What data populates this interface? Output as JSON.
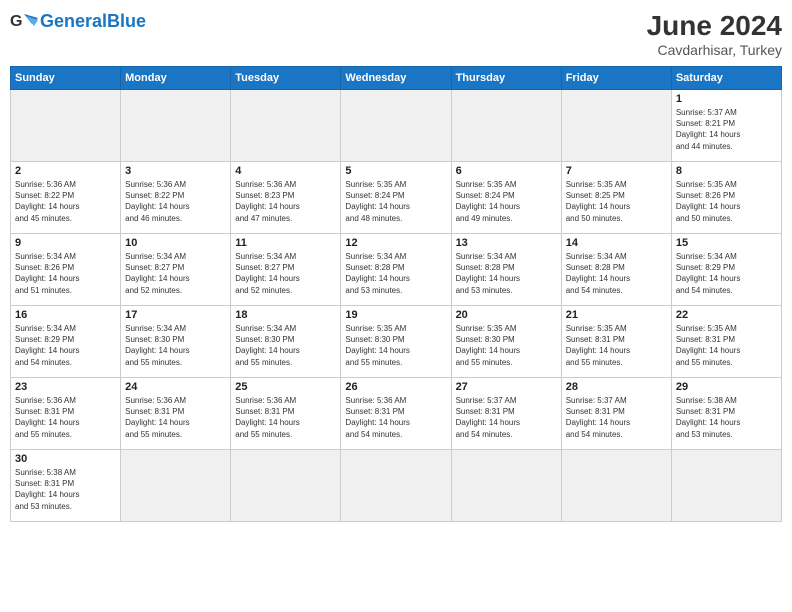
{
  "header": {
    "logo_general": "General",
    "logo_blue": "Blue",
    "month_year": "June 2024",
    "location": "Cavdarhisar, Turkey"
  },
  "days_of_week": [
    "Sunday",
    "Monday",
    "Tuesday",
    "Wednesday",
    "Thursday",
    "Friday",
    "Saturday"
  ],
  "weeks": [
    [
      {
        "day": "",
        "info": "",
        "empty": true
      },
      {
        "day": "",
        "info": "",
        "empty": true
      },
      {
        "day": "",
        "info": "",
        "empty": true
      },
      {
        "day": "",
        "info": "",
        "empty": true
      },
      {
        "day": "",
        "info": "",
        "empty": true
      },
      {
        "day": "",
        "info": "",
        "empty": true
      },
      {
        "day": "1",
        "info": "Sunrise: 5:37 AM\nSunset: 8:21 PM\nDaylight: 14 hours\nand 44 minutes."
      }
    ],
    [
      {
        "day": "2",
        "info": "Sunrise: 5:36 AM\nSunset: 8:22 PM\nDaylight: 14 hours\nand 45 minutes."
      },
      {
        "day": "3",
        "info": "Sunrise: 5:36 AM\nSunset: 8:22 PM\nDaylight: 14 hours\nand 46 minutes."
      },
      {
        "day": "4",
        "info": "Sunrise: 5:36 AM\nSunset: 8:23 PM\nDaylight: 14 hours\nand 47 minutes."
      },
      {
        "day": "5",
        "info": "Sunrise: 5:35 AM\nSunset: 8:24 PM\nDaylight: 14 hours\nand 48 minutes."
      },
      {
        "day": "6",
        "info": "Sunrise: 5:35 AM\nSunset: 8:24 PM\nDaylight: 14 hours\nand 49 minutes."
      },
      {
        "day": "7",
        "info": "Sunrise: 5:35 AM\nSunset: 8:25 PM\nDaylight: 14 hours\nand 50 minutes."
      },
      {
        "day": "8",
        "info": "Sunrise: 5:35 AM\nSunset: 8:26 PM\nDaylight: 14 hours\nand 50 minutes."
      }
    ],
    [
      {
        "day": "9",
        "info": "Sunrise: 5:34 AM\nSunset: 8:26 PM\nDaylight: 14 hours\nand 51 minutes."
      },
      {
        "day": "10",
        "info": "Sunrise: 5:34 AM\nSunset: 8:27 PM\nDaylight: 14 hours\nand 52 minutes."
      },
      {
        "day": "11",
        "info": "Sunrise: 5:34 AM\nSunset: 8:27 PM\nDaylight: 14 hours\nand 52 minutes."
      },
      {
        "day": "12",
        "info": "Sunrise: 5:34 AM\nSunset: 8:28 PM\nDaylight: 14 hours\nand 53 minutes."
      },
      {
        "day": "13",
        "info": "Sunrise: 5:34 AM\nSunset: 8:28 PM\nDaylight: 14 hours\nand 53 minutes."
      },
      {
        "day": "14",
        "info": "Sunrise: 5:34 AM\nSunset: 8:28 PM\nDaylight: 14 hours\nand 54 minutes."
      },
      {
        "day": "15",
        "info": "Sunrise: 5:34 AM\nSunset: 8:29 PM\nDaylight: 14 hours\nand 54 minutes."
      }
    ],
    [
      {
        "day": "16",
        "info": "Sunrise: 5:34 AM\nSunset: 8:29 PM\nDaylight: 14 hours\nand 54 minutes."
      },
      {
        "day": "17",
        "info": "Sunrise: 5:34 AM\nSunset: 8:30 PM\nDaylight: 14 hours\nand 55 minutes."
      },
      {
        "day": "18",
        "info": "Sunrise: 5:34 AM\nSunset: 8:30 PM\nDaylight: 14 hours\nand 55 minutes."
      },
      {
        "day": "19",
        "info": "Sunrise: 5:35 AM\nSunset: 8:30 PM\nDaylight: 14 hours\nand 55 minutes."
      },
      {
        "day": "20",
        "info": "Sunrise: 5:35 AM\nSunset: 8:30 PM\nDaylight: 14 hours\nand 55 minutes."
      },
      {
        "day": "21",
        "info": "Sunrise: 5:35 AM\nSunset: 8:31 PM\nDaylight: 14 hours\nand 55 minutes."
      },
      {
        "day": "22",
        "info": "Sunrise: 5:35 AM\nSunset: 8:31 PM\nDaylight: 14 hours\nand 55 minutes."
      }
    ],
    [
      {
        "day": "23",
        "info": "Sunrise: 5:36 AM\nSunset: 8:31 PM\nDaylight: 14 hours\nand 55 minutes."
      },
      {
        "day": "24",
        "info": "Sunrise: 5:36 AM\nSunset: 8:31 PM\nDaylight: 14 hours\nand 55 minutes."
      },
      {
        "day": "25",
        "info": "Sunrise: 5:36 AM\nSunset: 8:31 PM\nDaylight: 14 hours\nand 55 minutes."
      },
      {
        "day": "26",
        "info": "Sunrise: 5:36 AM\nSunset: 8:31 PM\nDaylight: 14 hours\nand 54 minutes."
      },
      {
        "day": "27",
        "info": "Sunrise: 5:37 AM\nSunset: 8:31 PM\nDaylight: 14 hours\nand 54 minutes."
      },
      {
        "day": "28",
        "info": "Sunrise: 5:37 AM\nSunset: 8:31 PM\nDaylight: 14 hours\nand 54 minutes."
      },
      {
        "day": "29",
        "info": "Sunrise: 5:38 AM\nSunset: 8:31 PM\nDaylight: 14 hours\nand 53 minutes."
      }
    ],
    [
      {
        "day": "30",
        "info": "Sunrise: 5:38 AM\nSunset: 8:31 PM\nDaylight: 14 hours\nand 53 minutes."
      },
      {
        "day": "",
        "info": "",
        "empty": true
      },
      {
        "day": "",
        "info": "",
        "empty": true
      },
      {
        "day": "",
        "info": "",
        "empty": true
      },
      {
        "day": "",
        "info": "",
        "empty": true
      },
      {
        "day": "",
        "info": "",
        "empty": true
      },
      {
        "day": "",
        "info": "",
        "empty": true
      }
    ]
  ]
}
